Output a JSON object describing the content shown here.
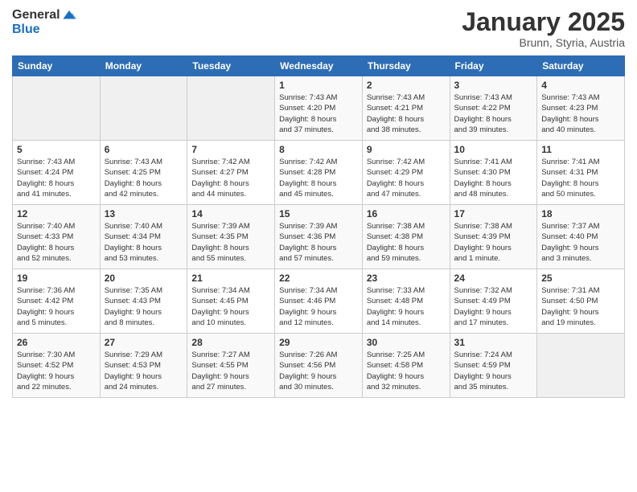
{
  "logo": {
    "general": "General",
    "blue": "Blue"
  },
  "title": "January 2025",
  "location": "Brunn, Styria, Austria",
  "headers": [
    "Sunday",
    "Monday",
    "Tuesday",
    "Wednesday",
    "Thursday",
    "Friday",
    "Saturday"
  ],
  "weeks": [
    [
      {
        "day": "",
        "info": ""
      },
      {
        "day": "",
        "info": ""
      },
      {
        "day": "",
        "info": ""
      },
      {
        "day": "1",
        "info": "Sunrise: 7:43 AM\nSunset: 4:20 PM\nDaylight: 8 hours\nand 37 minutes."
      },
      {
        "day": "2",
        "info": "Sunrise: 7:43 AM\nSunset: 4:21 PM\nDaylight: 8 hours\nand 38 minutes."
      },
      {
        "day": "3",
        "info": "Sunrise: 7:43 AM\nSunset: 4:22 PM\nDaylight: 8 hours\nand 39 minutes."
      },
      {
        "day": "4",
        "info": "Sunrise: 7:43 AM\nSunset: 4:23 PM\nDaylight: 8 hours\nand 40 minutes."
      }
    ],
    [
      {
        "day": "5",
        "info": "Sunrise: 7:43 AM\nSunset: 4:24 PM\nDaylight: 8 hours\nand 41 minutes."
      },
      {
        "day": "6",
        "info": "Sunrise: 7:43 AM\nSunset: 4:25 PM\nDaylight: 8 hours\nand 42 minutes."
      },
      {
        "day": "7",
        "info": "Sunrise: 7:42 AM\nSunset: 4:27 PM\nDaylight: 8 hours\nand 44 minutes."
      },
      {
        "day": "8",
        "info": "Sunrise: 7:42 AM\nSunset: 4:28 PM\nDaylight: 8 hours\nand 45 minutes."
      },
      {
        "day": "9",
        "info": "Sunrise: 7:42 AM\nSunset: 4:29 PM\nDaylight: 8 hours\nand 47 minutes."
      },
      {
        "day": "10",
        "info": "Sunrise: 7:41 AM\nSunset: 4:30 PM\nDaylight: 8 hours\nand 48 minutes."
      },
      {
        "day": "11",
        "info": "Sunrise: 7:41 AM\nSunset: 4:31 PM\nDaylight: 8 hours\nand 50 minutes."
      }
    ],
    [
      {
        "day": "12",
        "info": "Sunrise: 7:40 AM\nSunset: 4:33 PM\nDaylight: 8 hours\nand 52 minutes."
      },
      {
        "day": "13",
        "info": "Sunrise: 7:40 AM\nSunset: 4:34 PM\nDaylight: 8 hours\nand 53 minutes."
      },
      {
        "day": "14",
        "info": "Sunrise: 7:39 AM\nSunset: 4:35 PM\nDaylight: 8 hours\nand 55 minutes."
      },
      {
        "day": "15",
        "info": "Sunrise: 7:39 AM\nSunset: 4:36 PM\nDaylight: 8 hours\nand 57 minutes."
      },
      {
        "day": "16",
        "info": "Sunrise: 7:38 AM\nSunset: 4:38 PM\nDaylight: 8 hours\nand 59 minutes."
      },
      {
        "day": "17",
        "info": "Sunrise: 7:38 AM\nSunset: 4:39 PM\nDaylight: 9 hours\nand 1 minute."
      },
      {
        "day": "18",
        "info": "Sunrise: 7:37 AM\nSunset: 4:40 PM\nDaylight: 9 hours\nand 3 minutes."
      }
    ],
    [
      {
        "day": "19",
        "info": "Sunrise: 7:36 AM\nSunset: 4:42 PM\nDaylight: 9 hours\nand 5 minutes."
      },
      {
        "day": "20",
        "info": "Sunrise: 7:35 AM\nSunset: 4:43 PM\nDaylight: 9 hours\nand 8 minutes."
      },
      {
        "day": "21",
        "info": "Sunrise: 7:34 AM\nSunset: 4:45 PM\nDaylight: 9 hours\nand 10 minutes."
      },
      {
        "day": "22",
        "info": "Sunrise: 7:34 AM\nSunset: 4:46 PM\nDaylight: 9 hours\nand 12 minutes."
      },
      {
        "day": "23",
        "info": "Sunrise: 7:33 AM\nSunset: 4:48 PM\nDaylight: 9 hours\nand 14 minutes."
      },
      {
        "day": "24",
        "info": "Sunrise: 7:32 AM\nSunset: 4:49 PM\nDaylight: 9 hours\nand 17 minutes."
      },
      {
        "day": "25",
        "info": "Sunrise: 7:31 AM\nSunset: 4:50 PM\nDaylight: 9 hours\nand 19 minutes."
      }
    ],
    [
      {
        "day": "26",
        "info": "Sunrise: 7:30 AM\nSunset: 4:52 PM\nDaylight: 9 hours\nand 22 minutes."
      },
      {
        "day": "27",
        "info": "Sunrise: 7:29 AM\nSunset: 4:53 PM\nDaylight: 9 hours\nand 24 minutes."
      },
      {
        "day": "28",
        "info": "Sunrise: 7:27 AM\nSunset: 4:55 PM\nDaylight: 9 hours\nand 27 minutes."
      },
      {
        "day": "29",
        "info": "Sunrise: 7:26 AM\nSunset: 4:56 PM\nDaylight: 9 hours\nand 30 minutes."
      },
      {
        "day": "30",
        "info": "Sunrise: 7:25 AM\nSunset: 4:58 PM\nDaylight: 9 hours\nand 32 minutes."
      },
      {
        "day": "31",
        "info": "Sunrise: 7:24 AM\nSunset: 4:59 PM\nDaylight: 9 hours\nand 35 minutes."
      },
      {
        "day": "",
        "info": ""
      }
    ]
  ]
}
